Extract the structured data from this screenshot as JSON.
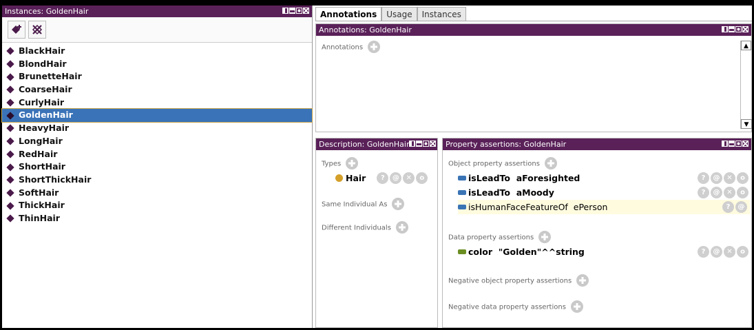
{
  "left_panel": {
    "title": "Instances: GoldenHair",
    "toolbar": {
      "add_icon": "add-individual-icon",
      "delete_icon": "delete-individual-icon"
    },
    "items": [
      {
        "label": "BlackHair"
      },
      {
        "label": "BlondHair"
      },
      {
        "label": "BrunetteHair"
      },
      {
        "label": "CoarseHair"
      },
      {
        "label": "CurlyHair"
      },
      {
        "label": "GoldenHair",
        "selected": true
      },
      {
        "label": "HeavyHair"
      },
      {
        "label": "LongHair"
      },
      {
        "label": "RedHair"
      },
      {
        "label": "ShortHair"
      },
      {
        "label": "ShortThickHair"
      },
      {
        "label": "SoftHair"
      },
      {
        "label": "ThickHair"
      },
      {
        "label": "ThinHair"
      }
    ]
  },
  "tabs": [
    {
      "label": "Annotations",
      "active": true
    },
    {
      "label": "Usage"
    },
    {
      "label": "Instances"
    }
  ],
  "annotations_panel": {
    "title": "Annotations: GoldenHair",
    "section_label": "Annotations"
  },
  "description_panel": {
    "title": "Description: GoldenHair",
    "types_label": "Types",
    "type_value": "Hair",
    "same_individual_label": "Same Individual As",
    "different_individuals_label": "Different Individuals"
  },
  "property_panel": {
    "title": "Property assertions: GoldenHair",
    "object_label": "Object property assertions",
    "object_assertions": [
      {
        "text": "isLeadTo  aForesighted",
        "bold": true
      },
      {
        "text": "isLeadTo  aMoody",
        "bold": true
      },
      {
        "text": "isHumanFaceFeatureOf  ePerson",
        "bold": false
      }
    ],
    "data_label": "Data property assertions",
    "data_assertions": [
      {
        "text": "color  \"Golden\"^^string"
      }
    ],
    "negative_object_label": "Negative object property assertions",
    "negative_data_label": "Negative data property assertions"
  },
  "colors": {
    "title_bar": "#5a2159",
    "selection": "#3a73b8",
    "object_property": "#3a74b5",
    "data_property": "#6b8e23",
    "class_dot": "#d4a02a"
  }
}
